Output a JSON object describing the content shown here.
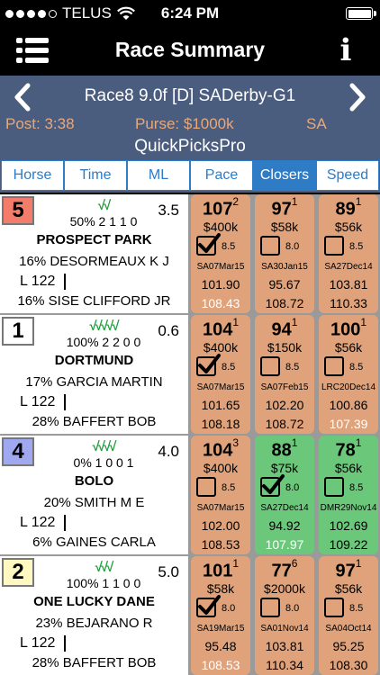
{
  "status_bar": {
    "carrier": "TELUS",
    "time": "6:24 PM",
    "signal_dots": 4
  },
  "nav": {
    "title": "Race Summary",
    "menu_icon": "list-icon",
    "info_icon": "info-icon"
  },
  "race": {
    "name": "Race8  9.0f  [D]  SADerby-G1",
    "post": "Post: 3:38",
    "purse": "Purse: $1000k",
    "track": "SA",
    "subtitle": "QuickPicksPro"
  },
  "tabs": [
    "Horse",
    "Time",
    "ML",
    "Pace",
    "Closers",
    "Speed"
  ],
  "active_tab": "Closers",
  "colors": {
    "tan": "#e0a27a",
    "green": "#6bc77a",
    "header": "#4a5d7f",
    "tab_blue": "#2e7bc6",
    "check_green": "#1da03c"
  },
  "horses": [
    {
      "post": "5",
      "post_color": "#f47c6a",
      "checks": "√√",
      "odds": "3.5",
      "stats": "50% 2 1 1 0",
      "name": "PROSPECT PARK",
      "jockey": "16% DESORMEAUX K J",
      "weight": "L 122",
      "trainer": "16% SISE CLIFFORD JR",
      "races": [
        {
          "fig": "107",
          "sup": "2",
          "purse": "$400k",
          "checked": true,
          "num": "8.5",
          "date": "SA07Mar15",
          "n1": "101.90",
          "n2": "108.43",
          "n2_white": true,
          "color": "tan"
        },
        {
          "fig": "97",
          "sup": "1",
          "purse": "$58k",
          "checked": false,
          "num": "8.0",
          "date": "SA30Jan15",
          "n1": "95.67",
          "n2": "108.72",
          "n2_white": false,
          "color": "tan"
        },
        {
          "fig": "89",
          "sup": "1",
          "purse": "$56k",
          "checked": false,
          "num": "8.5",
          "date": "SA27Dec14",
          "n1": "103.81",
          "n2": "110.33",
          "n2_white": false,
          "color": "tan"
        }
      ]
    },
    {
      "post": "1",
      "post_color": "#ffffff",
      "checks": "√√√√√",
      "odds": "0.6",
      "stats": "100% 2 2 0 0",
      "name": "DORTMUND",
      "jockey": "17% GARCIA MARTIN",
      "weight": "L 122",
      "trainer": "28% BAFFERT BOB",
      "races": [
        {
          "fig": "104",
          "sup": "1",
          "purse": "$400k",
          "checked": true,
          "num": "8.5",
          "date": "SA07Mar15",
          "n1": "101.65",
          "n2": "108.18",
          "n2_white": false,
          "color": "tan"
        },
        {
          "fig": "94",
          "sup": "1",
          "purse": "$150k",
          "checked": false,
          "num": "8.5",
          "date": "SA07Feb15",
          "n1": "102.20",
          "n2": "108.72",
          "n2_white": false,
          "color": "tan"
        },
        {
          "fig": "100",
          "sup": "1",
          "purse": "$56k",
          "checked": false,
          "num": "8.5",
          "date": "LRC20Dec14",
          "n1": "100.86",
          "n2": "107.39",
          "n2_white": true,
          "color": "tan"
        }
      ]
    },
    {
      "post": "4",
      "post_color": "#a0a8f0",
      "checks": "√√√√",
      "odds": "4.0",
      "stats": "0% 1 0 0 1",
      "name": "BOLO",
      "jockey": "20% SMITH M E",
      "weight": "L 122",
      "trainer": "6% GAINES CARLA",
      "races": [
        {
          "fig": "104",
          "sup": "3",
          "purse": "$400k",
          "checked": false,
          "num": "8.5",
          "date": "SA07Mar15",
          "n1": "102.00",
          "n2": "108.53",
          "n2_white": false,
          "color": "tan"
        },
        {
          "fig": "88",
          "sup": "1",
          "purse": "$75k",
          "checked": true,
          "num": "8.0",
          "date": "SA27Dec14",
          "n1": "94.92",
          "n2": "107.97",
          "n2_white": true,
          "color": "green"
        },
        {
          "fig": "78",
          "sup": "1",
          "purse": "$56k",
          "checked": false,
          "num": "8.5",
          "date": "DMR29Nov14",
          "n1": "102.69",
          "n2": "109.22",
          "n2_white": false,
          "color": "green"
        }
      ]
    },
    {
      "post": "2",
      "post_color": "#fff8c0",
      "checks": "√√√",
      "odds": "5.0",
      "stats": "100% 1 1 0 0",
      "name": "ONE LUCKY DANE",
      "jockey": "23% BEJARANO R",
      "weight": "L 122",
      "trainer": "28% BAFFERT BOB",
      "races": [
        {
          "fig": "101",
          "sup": "1",
          "purse": "$58k",
          "checked": true,
          "num": "8.0",
          "date": "SA19Mar15",
          "n1": "95.48",
          "n2": "108.53",
          "n2_white": true,
          "color": "tan"
        },
        {
          "fig": "77",
          "sup": "6",
          "purse": "$2000k",
          "checked": false,
          "num": "8.0",
          "date": "SA01Nov14",
          "n1": "103.81",
          "n2": "110.34",
          "n2_white": false,
          "color": "tan"
        },
        {
          "fig": "97",
          "sup": "1",
          "purse": "$56k",
          "checked": false,
          "num": "8.5",
          "date": "SA04Oct14",
          "n1": "95.25",
          "n2": "108.30",
          "n2_white": false,
          "color": "tan"
        }
      ]
    }
  ]
}
